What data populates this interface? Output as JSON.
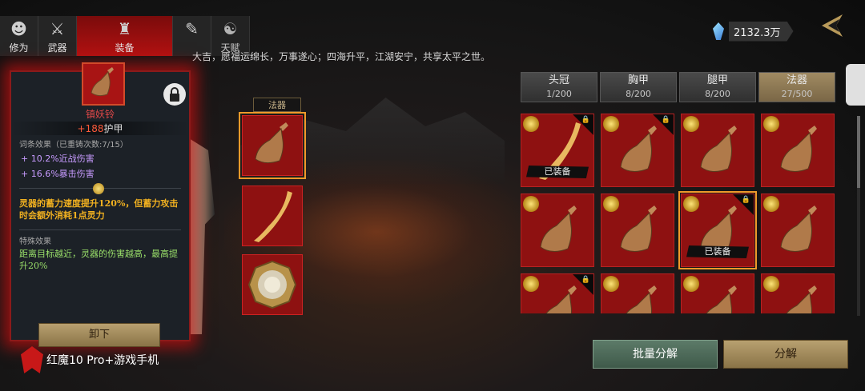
{
  "nav_tabs": [
    {
      "label": "修为",
      "icon": "character-head-icon"
    },
    {
      "label": "武器",
      "icon": "sword-icon"
    },
    {
      "label": "装备",
      "icon": "robe-icon"
    },
    {
      "label": "",
      "icon": "scroll-icon"
    },
    {
      "label": "天赋",
      "icon": "yin-yang-icon"
    }
  ],
  "announcement": "大吉，愿福运绵长，万事遂心；四海升平，江湖安宁，共享太平之世。",
  "currency": {
    "value": "2132.3万",
    "icon": "crystal-icon"
  },
  "detail": {
    "name": "镇妖铃",
    "stat_value": "+188",
    "stat_label": "护甲",
    "affix_header": "词条效果（已重铸次数:7/15）",
    "affixes": [
      "+ 10.2%近战伤害",
      "+ 16.6%暴击伤害"
    ],
    "gold_effect": "灵器的蓄力速度提升120%，但蓄力攻击时会额外消耗1点灵力",
    "special_header": "特殊效果",
    "special_effect": "距离目标越近，灵器的伤害越高，最高提升20%",
    "unequip_label": "卸下"
  },
  "slot_column": {
    "label": "法器"
  },
  "categories": [
    {
      "name": "头冠",
      "count": "1/200"
    },
    {
      "name": "胸甲",
      "count": "8/200"
    },
    {
      "name": "腿甲",
      "count": "8/200"
    },
    {
      "name": "法器",
      "count": "27/500"
    }
  ],
  "equipped_tag": "已装备",
  "grid_items": [
    {
      "kind": "ribbon",
      "locked": true,
      "equipped": true
    },
    {
      "kind": "bell",
      "locked": true,
      "equipped": false
    },
    {
      "kind": "bell",
      "locked": false,
      "equipped": false
    },
    {
      "kind": "bell",
      "locked": false,
      "equipped": false
    },
    {
      "kind": "bell",
      "locked": false,
      "equipped": false
    },
    {
      "kind": "bell",
      "locked": false,
      "equipped": false
    },
    {
      "kind": "bell",
      "locked": true,
      "equipped": true,
      "selected": true
    },
    {
      "kind": "bell",
      "locked": false,
      "equipped": false
    },
    {
      "kind": "bell",
      "locked": true,
      "equipped": false
    },
    {
      "kind": "bell",
      "locked": false,
      "equipped": false
    },
    {
      "kind": "bell",
      "locked": false,
      "equipped": false
    },
    {
      "kind": "bell",
      "locked": false,
      "equipped": false
    }
  ],
  "buttons": {
    "batch_decompose": "批量分解",
    "decompose": "分解"
  },
  "watermark": "红魔10 Pro+游戏手机",
  "colors": {
    "accent_red": "#b21212",
    "gold": "#f0b020",
    "affix_purple": "#c79bff",
    "special_green": "#9ae06a"
  }
}
